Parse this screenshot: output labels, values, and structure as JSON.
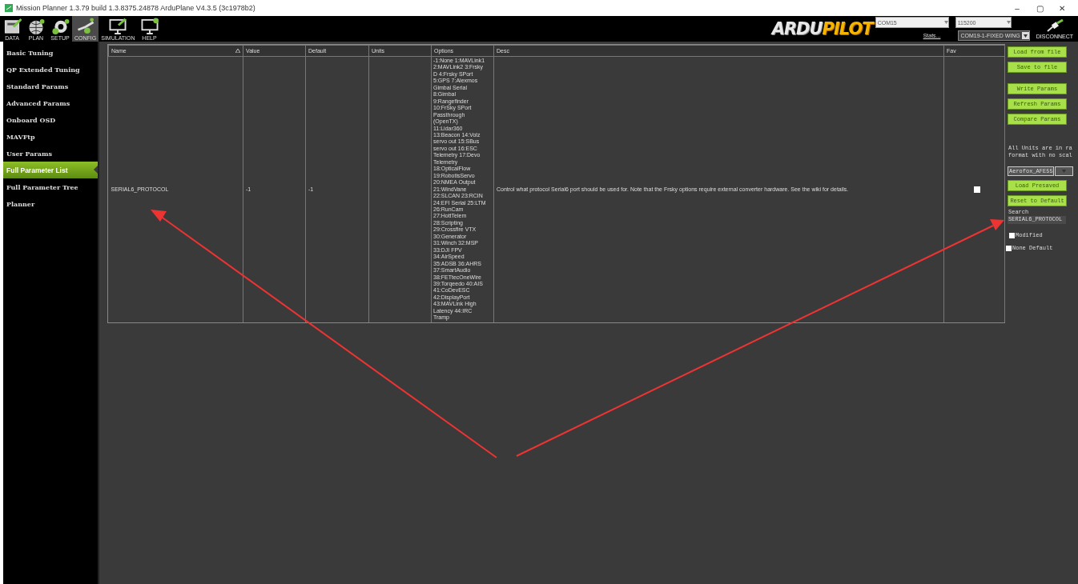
{
  "window": {
    "title": "Mission Planner 1.3.79 build 1.3.8375.24878 ArduPlane V4.3.5 (3c1978b2)",
    "controls": [
      "–",
      "▢",
      "✕"
    ]
  },
  "toolbar": {
    "items": [
      {
        "label": "DATA",
        "selected": false
      },
      {
        "label": "PLAN",
        "selected": false
      },
      {
        "label": "SETUP",
        "selected": false
      },
      {
        "label": "CONFIG",
        "selected": true
      },
      {
        "label": "SIMULATION",
        "selected": false
      },
      {
        "label": "HELP",
        "selected": false
      }
    ],
    "logo": {
      "left": "ARDU",
      "right": "PILOT"
    },
    "port": "COM15",
    "baud": "115200",
    "stats": "Stats...",
    "link": "COM19-1-FIXED WING",
    "disconnect": "DISCONNECT"
  },
  "sidebar": {
    "items": [
      {
        "label": "Basic Tuning",
        "selected": false
      },
      {
        "label": "QP Extended Tuning",
        "selected": false
      },
      {
        "label": "Standard Params",
        "selected": false
      },
      {
        "label": "Advanced Params",
        "selected": false
      },
      {
        "label": "Onboard OSD",
        "selected": false
      },
      {
        "label": "MAVFtp",
        "selected": false
      },
      {
        "label": "User Params",
        "selected": false
      },
      {
        "label": "Full Parameter List",
        "selected": true
      },
      {
        "label": "Full Parameter Tree",
        "selected": false
      },
      {
        "label": "Planner",
        "selected": false
      }
    ]
  },
  "table": {
    "columns": [
      "Name",
      "Value",
      "Default",
      "Units",
      "Options",
      "Desc",
      "Fav"
    ],
    "rows": [
      {
        "name": "SERIAL6_PROTOCOL",
        "value": "-1",
        "default": "-1",
        "units": "",
        "options": "-1:None 1:MAVLink1\n2:MAVLink2 3:Frsky\nD 4:Frsky SPort\n5:GPS 7:Alexmos\nGimbal Serial\n8:Gimbal\n9:Rangefinder\n10:FrSky SPort\nPassthrough\n(OpenTX)\n11:Lidar360\n13:Beacon 14:Volz\nservo out 15:SBus\nservo out 16:ESC\nTelemetry 17:Devo\nTelemetry\n18:OpticalFlow\n19:RobotisServo\n20:NMEA Output\n21:WindVane\n22:SLCAN 23:RCIN\n24:EFI Serial 25:LTM\n26:RunCam\n27:HottTelem\n28:Scripting\n29:Crossfire VTX\n30:Generator\n31:Winch 32:MSP\n33:DJI FPV\n34:AirSpeed\n35:ADSB 36:AHRS\n37:SmartAudio\n38:FETtecOneWire\n39:Torqeedo 40:AIS\n41:CoDevESC\n42:DisplayPort\n43:MAVLink High\nLatency 44:IRC\nTramp",
        "desc": "Control what protocol Serial6 port should be used for. Note that the Frsky options require external converter hardware. See the wiki for details.",
        "fav": false
      }
    ]
  },
  "panel": {
    "buttons_top": [
      "Load from file",
      "Save to file"
    ],
    "buttons_mid": [
      "Write Params",
      "Refresh Params",
      "Compare Params"
    ],
    "note": "All Units are in ra\nformat with no scal",
    "preset": "Aerofox_AFE55",
    "buttons_bottom": [
      "Load Presaved",
      "Reset to Default"
    ],
    "search_label": "Search",
    "search_value": "SERIAL6_PROTOCOL",
    "filters": [
      {
        "label": "Modified",
        "checked": false
      },
      {
        "label": "None Default",
        "checked": false
      }
    ]
  }
}
